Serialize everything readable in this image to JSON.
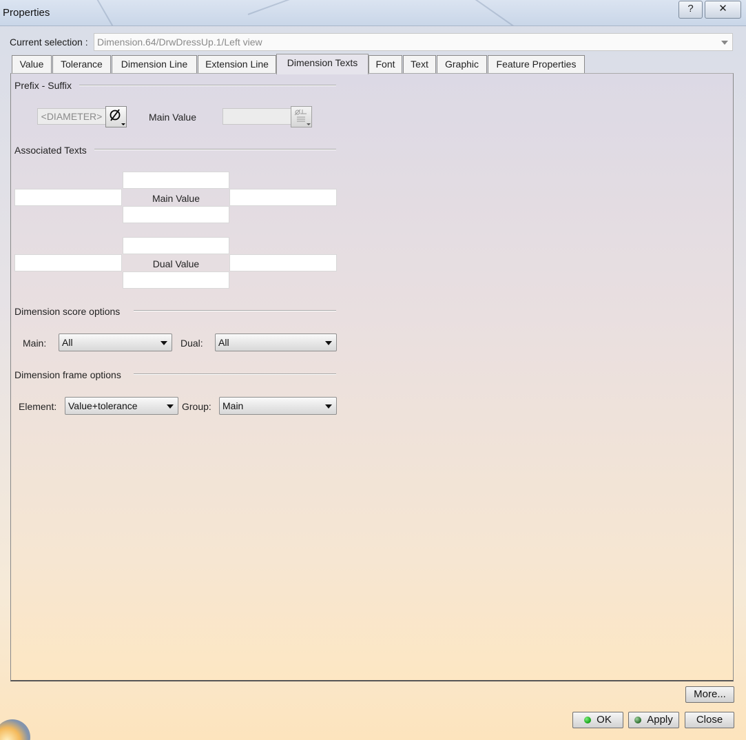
{
  "window": {
    "title": "Properties",
    "help_label": "?",
    "close_label": "✕"
  },
  "selection": {
    "label": "Current selection :",
    "value": "Dimension.64/DrwDressUp.1/Left view"
  },
  "tabs": [
    {
      "label": "Value"
    },
    {
      "label": "Tolerance"
    },
    {
      "label": "Dimension Line"
    },
    {
      "label": "Extension Line"
    },
    {
      "label": "Dimension Texts",
      "active": true
    },
    {
      "label": "Font"
    },
    {
      "label": "Text"
    },
    {
      "label": "Graphic"
    },
    {
      "label": "Feature Properties"
    }
  ],
  "prefix_suffix": {
    "title": "Prefix - Suffix",
    "symbol_field": "<DIAMETER>",
    "main_value_label": "Main Value"
  },
  "associated_texts": {
    "title": "Associated Texts",
    "main_value_label": "Main Value",
    "dual_value_label": "Dual Value"
  },
  "score_options": {
    "title": "Dimension score options",
    "main_label": "Main:",
    "main_value": "All",
    "dual_label": "Dual:",
    "dual_value": "All"
  },
  "frame_options": {
    "title": "Dimension frame options",
    "element_label": "Element:",
    "element_value": "Value+tolerance",
    "group_label": "Group:",
    "group_value": "Main"
  },
  "buttons": {
    "more": "More...",
    "ok": "OK",
    "apply": "Apply",
    "close": "Close"
  },
  "icons": {
    "diameter": "diameter-symbol-icon",
    "format": "text-format-icon",
    "dropdown": "chevron-down-icon"
  }
}
